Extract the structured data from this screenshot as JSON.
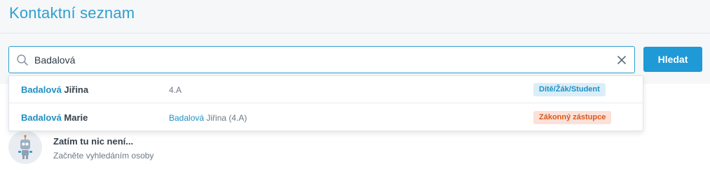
{
  "header": {
    "title": "Kontaktní seznam"
  },
  "search": {
    "value": "Badalová",
    "button_label": "Hledat",
    "icons": {
      "search": "search-icon",
      "clear": "close-icon"
    }
  },
  "results": [
    {
      "name_highlight": "Badalová",
      "name_rest": " Jiřina",
      "meta_highlight": "",
      "meta_rest": "4.A",
      "badge": "Dítě/Žák/Student",
      "badge_type": "student"
    },
    {
      "name_highlight": "Badalová",
      "name_rest": " Marie",
      "meta_highlight": "Badalová",
      "meta_rest": " Jiřina (4.A)",
      "badge": "Zákonný zástupce",
      "badge_type": "parent"
    }
  ],
  "empty_state": {
    "title": "Zatím tu nic není...",
    "subtitle": "Začněte vyhledáním osoby",
    "icon": "robot-icon"
  },
  "colors": {
    "accent": "#1f9ad6",
    "title": "#2e9fcf",
    "student_badge_bg": "#d9eef8",
    "parent_badge_bg": "#fbe1d8",
    "parent_badge_text": "#d9581e"
  }
}
